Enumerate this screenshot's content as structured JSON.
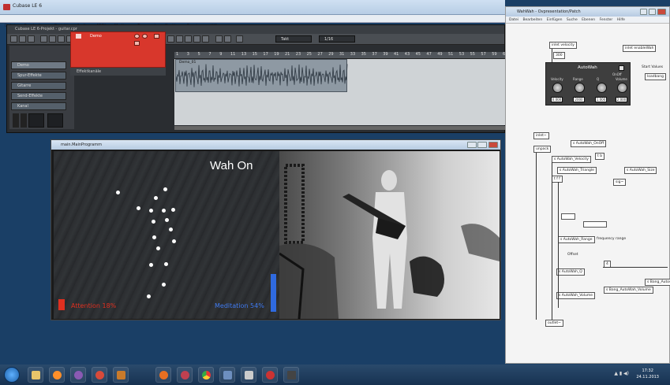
{
  "cubase": {
    "title": "Cubase LE 6",
    "menu": [
      "Datei",
      "Bearbeiten",
      "Projekt",
      "Audio",
      "MIDI",
      "Medien",
      "Transport",
      "Geräte",
      "Fenster",
      "Hilfe"
    ],
    "project_title": "Cubase LE 6-Projekt - guitar.cpr",
    "tracks": [
      "Demo",
      "Spur-Effekte",
      "Gitarre",
      "Send-Effekte",
      "Kanal"
    ],
    "selected_track": "Demo",
    "sub_track": "Effektkanäle",
    "ruler": [
      "1",
      "3",
      "5",
      "7",
      "9",
      "11",
      "13",
      "15",
      "17",
      "19",
      "21",
      "23",
      "25",
      "27",
      "29",
      "31",
      "33",
      "35",
      "37",
      "39",
      "41",
      "43",
      "45",
      "47",
      "49",
      "51",
      "53",
      "55",
      "57",
      "59",
      "61"
    ],
    "snap": "Takt",
    "quant": "1/16",
    "event": "Demo_01"
  },
  "wah": {
    "title": "main.MainProgramm",
    "label": "Wah On",
    "attention": "Attention 18%",
    "attention_value": 18,
    "meditation": "Meditation 54%",
    "meditation_value": 54
  },
  "patcher": {
    "title": "WahWah - Ovpresentation/Patch",
    "menu": [
      "Datei",
      "Bearbeiten",
      "Einfügen",
      "Suche",
      "Ebenen",
      "Fenster",
      "Hilfe"
    ],
    "autowah_title": "AutoWah",
    "knobs": [
      "Velocity",
      "Range",
      "Q",
      "Volume"
    ],
    "values": [
      "0.000",
      "2000",
      "1.000",
      "2.000"
    ],
    "objects": {
      "velocity": "inlet velocity",
      "enable": "inlet enableWah",
      "start": "Start Values",
      "onoff": "OnOff",
      "s_onoff": "s AutoWah_OnOff",
      "s_velocity": "s AutoWah_Velocity",
      "s_triangle": "s AutoWah_Triangle",
      "s_size": "s AutoWah_Size",
      "s_range": "s AutoWah_Range",
      "freq": "frequency range",
      "offset": "Offset",
      "s_q": "s AutoWah_Q",
      "s_volume": "s AutoWah_Volume",
      "bang_vol": "s Bang_AutoWah_Volume",
      "bang": "s Bang_Autow",
      "outlet": "outlet~",
      "inlet": "inlet~",
      "val300": "300",
      "val4": "4",
      "tr": "t b",
      "sig": "sig~",
      "trig": "t f f",
      "unpack": "unpack",
      "loadbang": "loadbang"
    }
  },
  "taskbar": {
    "time": "17:32",
    "date": "24.11.2013"
  }
}
